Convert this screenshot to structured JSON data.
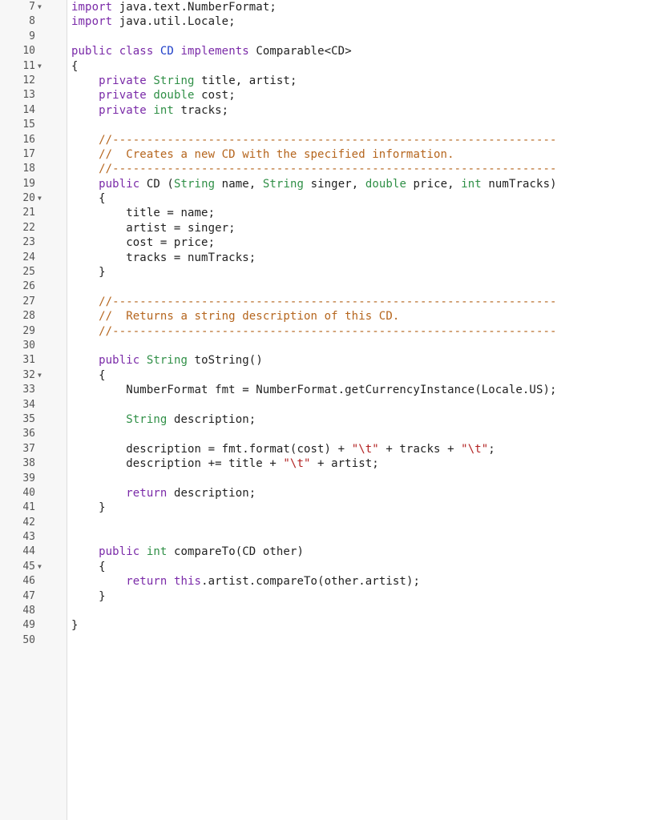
{
  "editor": {
    "colors": {
      "keyword": "#7a2aa8",
      "type": "#2f8f46",
      "class_name": "#2040c8",
      "comment": "#b5651d",
      "string": "#b22222",
      "plain": "#1f1f1f",
      "gutter_bg": "#f7f7f7"
    },
    "fold_icon": "fold-toggle-icon",
    "lines": [
      {
        "n": "7",
        "fold": true,
        "tokens": [
          [
            "kw",
            "import"
          ],
          [
            "pl",
            " java.text.NumberFormat;"
          ]
        ]
      },
      {
        "n": "8",
        "fold": false,
        "tokens": [
          [
            "kw",
            "import"
          ],
          [
            "pl",
            " java.util.Locale;"
          ]
        ]
      },
      {
        "n": "9",
        "fold": false,
        "tokens": []
      },
      {
        "n": "10",
        "fold": false,
        "tokens": [
          [
            "kw",
            "public"
          ],
          [
            "pl",
            " "
          ],
          [
            "kw",
            "class"
          ],
          [
            "pl",
            " "
          ],
          [
            "cls",
            "CD"
          ],
          [
            "pl",
            " "
          ],
          [
            "kw",
            "implements"
          ],
          [
            "pl",
            " Comparable<CD>"
          ]
        ]
      },
      {
        "n": "11",
        "fold": true,
        "tokens": [
          [
            "pl",
            "{"
          ]
        ]
      },
      {
        "n": "12",
        "fold": false,
        "tokens": [
          [
            "pl",
            "    "
          ],
          [
            "kw",
            "private"
          ],
          [
            "pl",
            " "
          ],
          [
            "ty",
            "String"
          ],
          [
            "pl",
            " title, artist;"
          ]
        ]
      },
      {
        "n": "13",
        "fold": false,
        "tokens": [
          [
            "pl",
            "    "
          ],
          [
            "kw",
            "private"
          ],
          [
            "pl",
            " "
          ],
          [
            "ty",
            "double"
          ],
          [
            "pl",
            " cost;"
          ]
        ]
      },
      {
        "n": "14",
        "fold": false,
        "tokens": [
          [
            "pl",
            "    "
          ],
          [
            "kw",
            "private"
          ],
          [
            "pl",
            " "
          ],
          [
            "ty",
            "int"
          ],
          [
            "pl",
            " tracks;"
          ]
        ]
      },
      {
        "n": "15",
        "fold": false,
        "tokens": []
      },
      {
        "n": "16",
        "fold": false,
        "tokens": [
          [
            "pl",
            "    "
          ],
          [
            "cm",
            "//-----------------------------------------------------------------"
          ]
        ]
      },
      {
        "n": "17",
        "fold": false,
        "tokens": [
          [
            "pl",
            "    "
          ],
          [
            "cm",
            "//  Creates a new CD with the specified information."
          ]
        ]
      },
      {
        "n": "18",
        "fold": false,
        "tokens": [
          [
            "pl",
            "    "
          ],
          [
            "cm",
            "//-----------------------------------------------------------------"
          ]
        ]
      },
      {
        "n": "19",
        "fold": false,
        "tokens": [
          [
            "pl",
            "    "
          ],
          [
            "kw",
            "public"
          ],
          [
            "pl",
            " CD ("
          ],
          [
            "ty",
            "String"
          ],
          [
            "pl",
            " name, "
          ],
          [
            "ty",
            "String"
          ],
          [
            "pl",
            " singer, "
          ],
          [
            "ty",
            "double"
          ],
          [
            "pl",
            " price, "
          ],
          [
            "ty",
            "int"
          ],
          [
            "pl",
            " numTracks)"
          ]
        ]
      },
      {
        "n": "20",
        "fold": true,
        "tokens": [
          [
            "pl",
            "    {"
          ]
        ]
      },
      {
        "n": "21",
        "fold": false,
        "tokens": [
          [
            "pl",
            "        title = name;"
          ]
        ]
      },
      {
        "n": "22",
        "fold": false,
        "tokens": [
          [
            "pl",
            "        artist = singer;"
          ]
        ]
      },
      {
        "n": "23",
        "fold": false,
        "tokens": [
          [
            "pl",
            "        cost = price;"
          ]
        ]
      },
      {
        "n": "24",
        "fold": false,
        "tokens": [
          [
            "pl",
            "        tracks = numTracks;"
          ]
        ]
      },
      {
        "n": "25",
        "fold": false,
        "tokens": [
          [
            "pl",
            "    }"
          ]
        ]
      },
      {
        "n": "26",
        "fold": false,
        "tokens": []
      },
      {
        "n": "27",
        "fold": false,
        "tokens": [
          [
            "pl",
            "    "
          ],
          [
            "cm",
            "//-----------------------------------------------------------------"
          ]
        ]
      },
      {
        "n": "28",
        "fold": false,
        "tokens": [
          [
            "pl",
            "    "
          ],
          [
            "cm",
            "//  Returns a string description of this CD."
          ]
        ]
      },
      {
        "n": "29",
        "fold": false,
        "tokens": [
          [
            "pl",
            "    "
          ],
          [
            "cm",
            "//-----------------------------------------------------------------"
          ]
        ]
      },
      {
        "n": "30",
        "fold": false,
        "tokens": []
      },
      {
        "n": "31",
        "fold": false,
        "tokens": [
          [
            "pl",
            "    "
          ],
          [
            "kw",
            "public"
          ],
          [
            "pl",
            " "
          ],
          [
            "ty",
            "String"
          ],
          [
            "pl",
            " toString()"
          ]
        ]
      },
      {
        "n": "32",
        "fold": true,
        "tokens": [
          [
            "pl",
            "    {"
          ]
        ]
      },
      {
        "n": "33",
        "fold": false,
        "tokens": [
          [
            "pl",
            "        NumberFormat fmt = NumberFormat.getCurrencyInstance(Locale.US);"
          ]
        ]
      },
      {
        "n": "34",
        "fold": false,
        "tokens": []
      },
      {
        "n": "35",
        "fold": false,
        "tokens": [
          [
            "pl",
            "        "
          ],
          [
            "ty",
            "String"
          ],
          [
            "pl",
            " description;"
          ]
        ]
      },
      {
        "n": "36",
        "fold": false,
        "tokens": []
      },
      {
        "n": "37",
        "fold": false,
        "tokens": [
          [
            "pl",
            "        description = fmt.format(cost) + "
          ],
          [
            "st",
            "\"\\t\""
          ],
          [
            "pl",
            " + tracks + "
          ],
          [
            "st",
            "\"\\t\""
          ],
          [
            "pl",
            ";"
          ]
        ]
      },
      {
        "n": "38",
        "fold": false,
        "tokens": [
          [
            "pl",
            "        description += title + "
          ],
          [
            "st",
            "\"\\t\""
          ],
          [
            "pl",
            " + artist;"
          ]
        ]
      },
      {
        "n": "39",
        "fold": false,
        "tokens": []
      },
      {
        "n": "40",
        "fold": false,
        "tokens": [
          [
            "pl",
            "        "
          ],
          [
            "kw",
            "return"
          ],
          [
            "pl",
            " description;"
          ]
        ]
      },
      {
        "n": "41",
        "fold": false,
        "tokens": [
          [
            "pl",
            "    }"
          ]
        ]
      },
      {
        "n": "42",
        "fold": false,
        "tokens": []
      },
      {
        "n": "43",
        "fold": false,
        "tokens": []
      },
      {
        "n": "44",
        "fold": false,
        "tokens": [
          [
            "pl",
            "    "
          ],
          [
            "kw",
            "public"
          ],
          [
            "pl",
            " "
          ],
          [
            "ty",
            "int"
          ],
          [
            "pl",
            " compareTo(CD other)"
          ]
        ]
      },
      {
        "n": "45",
        "fold": true,
        "tokens": [
          [
            "pl",
            "    {"
          ]
        ]
      },
      {
        "n": "46",
        "fold": false,
        "tokens": [
          [
            "pl",
            "        "
          ],
          [
            "kw",
            "return"
          ],
          [
            "pl",
            " "
          ],
          [
            "kw",
            "this"
          ],
          [
            "pl",
            ".artist.compareTo(other.artist);"
          ]
        ]
      },
      {
        "n": "47",
        "fold": false,
        "tokens": [
          [
            "pl",
            "    }"
          ]
        ]
      },
      {
        "n": "48",
        "fold": false,
        "tokens": []
      },
      {
        "n": "49",
        "fold": false,
        "tokens": [
          [
            "pl",
            "}"
          ]
        ]
      },
      {
        "n": "50",
        "fold": false,
        "tokens": []
      }
    ]
  }
}
